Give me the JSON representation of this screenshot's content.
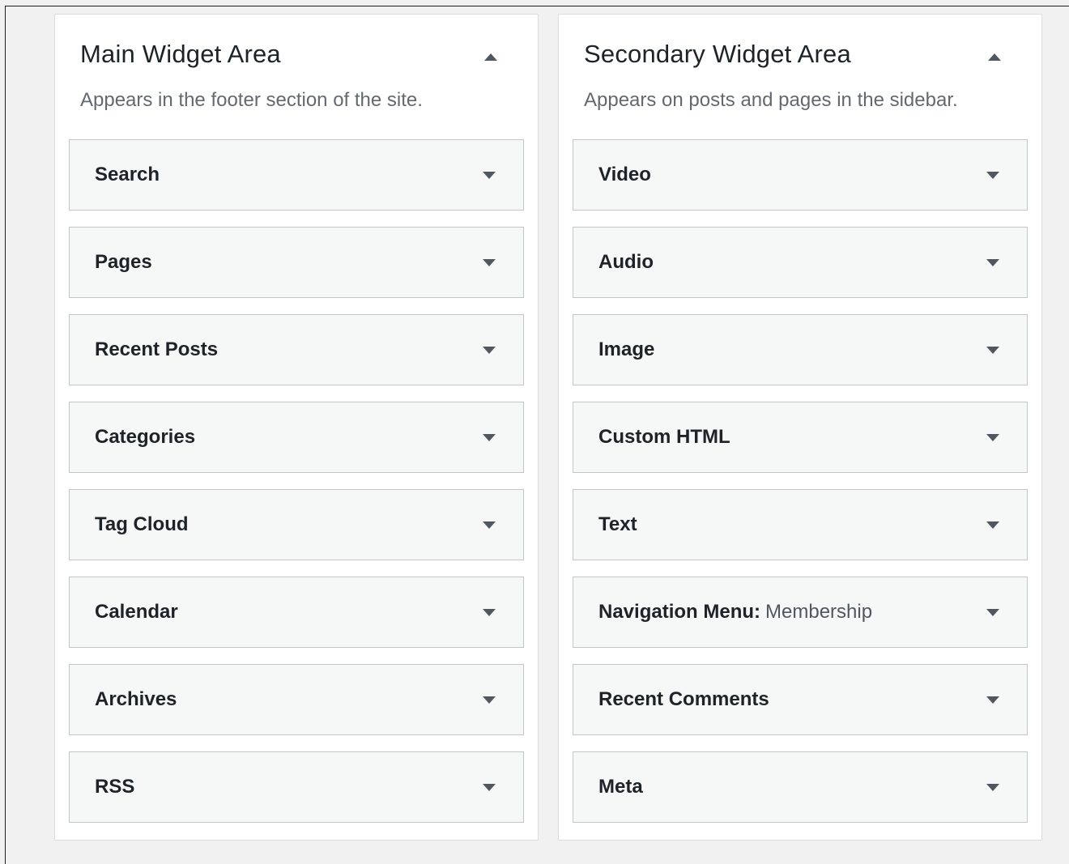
{
  "main_area": {
    "title": "Main Widget Area",
    "description": "Appears in the footer section of the site.",
    "widgets": [
      {
        "title": "Search"
      },
      {
        "title": "Pages"
      },
      {
        "title": "Recent Posts"
      },
      {
        "title": "Categories"
      },
      {
        "title": "Tag Cloud"
      },
      {
        "title": "Calendar"
      },
      {
        "title": "Archives"
      },
      {
        "title": "RSS"
      }
    ]
  },
  "secondary_area": {
    "title": "Secondary Widget Area",
    "description": "Appears on posts and pages in the sidebar.",
    "widgets": [
      {
        "title": "Video"
      },
      {
        "title": "Audio"
      },
      {
        "title": "Image"
      },
      {
        "title": "Custom HTML"
      },
      {
        "title": "Text"
      },
      {
        "title": "Navigation Menu:",
        "subtitle": "Membership"
      },
      {
        "title": "Recent Comments"
      },
      {
        "title": "Meta"
      }
    ]
  },
  "icons": {
    "area_toggle": "arrow-up-icon",
    "widget_toggle": "arrow-down-icon"
  },
  "colors": {
    "area_background": "#ffffff",
    "widget_background": "#f6f7f7",
    "border": "#c3c4c7",
    "text": "#1d2327",
    "muted_text": "#646970"
  }
}
